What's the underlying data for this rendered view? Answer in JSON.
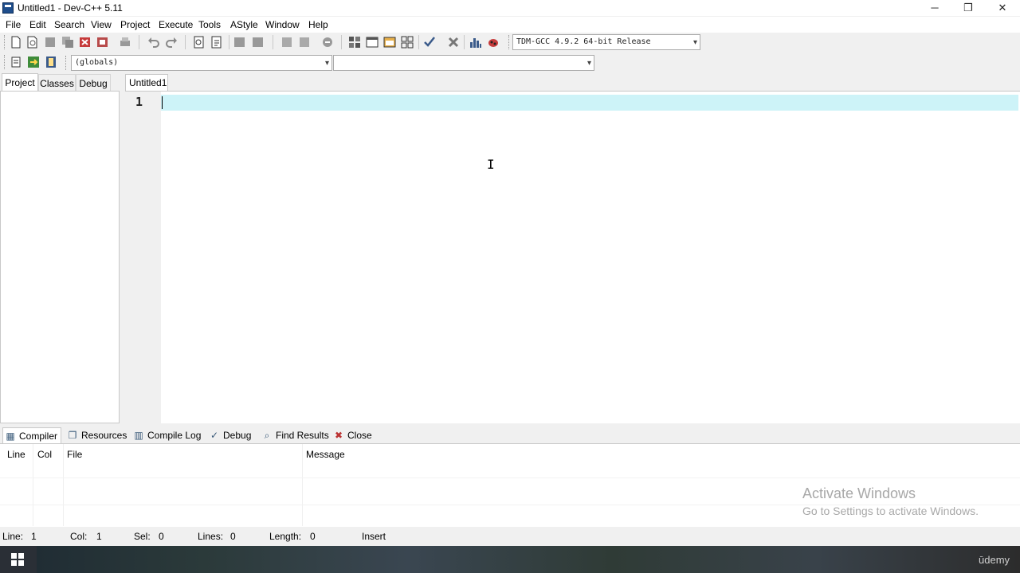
{
  "window": {
    "title": "Untitled1 - Dev-C++ 5.11",
    "minimize_glyph": "─",
    "restore_glyph": "❐",
    "close_glyph": "✕"
  },
  "menu": [
    "File",
    "Edit",
    "Search",
    "View",
    "Project",
    "Execute",
    "Tools",
    "AStyle",
    "Window",
    "Help"
  ],
  "toolbar": {
    "compiler_select": "TDM-GCC 4.9.2 64-bit Release",
    "scope_select": "(globals)",
    "member_select": ""
  },
  "left_panel": {
    "tabs": [
      "Project",
      "Classes",
      "Debug"
    ],
    "active_tab": "Project"
  },
  "editor": {
    "tab_label": "Untitled1",
    "line_number": "1",
    "highlight_color": "#cdf3f8"
  },
  "bottom_panel": {
    "tabs": [
      {
        "label": "Compiler",
        "icon": "compiler-icon"
      },
      {
        "label": "Resources",
        "icon": "resources-icon"
      },
      {
        "label": "Compile Log",
        "icon": "compile-log-icon"
      },
      {
        "label": "Debug",
        "icon": "debug-check-icon"
      },
      {
        "label": "Find Results",
        "icon": "find-results-icon"
      },
      {
        "label": "Close",
        "icon": "close-icon"
      }
    ],
    "columns": [
      "Line",
      "Col",
      "File",
      "Message"
    ]
  },
  "watermark": {
    "title": "Activate Windows",
    "subtitle": "Go to Settings to activate Windows."
  },
  "status": {
    "line_label": "Line:",
    "line_value": "1",
    "col_label": "Col:",
    "col_value": "1",
    "sel_label": "Sel:",
    "sel_value": "0",
    "lines_label": "Lines:",
    "lines_value": "0",
    "length_label": "Length:",
    "length_value": "0",
    "mode": "Insert"
  },
  "taskbar": {
    "brand": "ūdemy"
  }
}
